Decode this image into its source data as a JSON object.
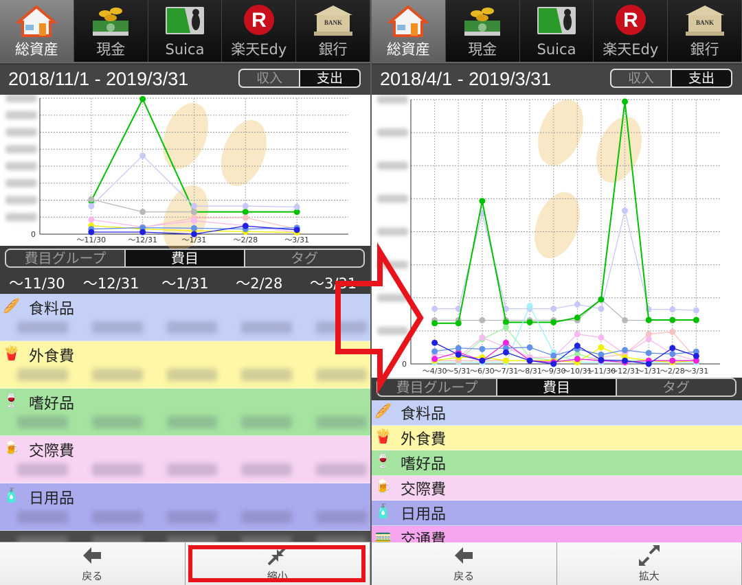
{
  "colors": {
    "accent_red": "#e8141c",
    "selected_tab": "#777777",
    "header_bg": "#444444"
  },
  "nav_tabs": [
    {
      "label": "総資産",
      "icon": "house-icon",
      "selected": true
    },
    {
      "label": "現金",
      "icon": "cash-icon",
      "selected": false
    },
    {
      "label": "Suica",
      "icon": "suica-card-icon",
      "selected": false
    },
    {
      "label": "楽天Edy",
      "icon": "rakuten-r-icon",
      "selected": false
    },
    {
      "label": "銀行",
      "icon": "bank-icon",
      "selected": false
    }
  ],
  "toggle": {
    "income": "収入",
    "expense": "支出",
    "selected": "支出"
  },
  "segments": {
    "items": [
      "費目グループ",
      "費目",
      "タグ"
    ],
    "selected": "費目"
  },
  "left_panel": {
    "date_range": "2018/11/1 - 2019/3/31",
    "columns": [
      "〜11/30",
      "〜12/31",
      "〜1/31",
      "〜2/28",
      "〜3/31"
    ],
    "rows": [
      {
        "name": "食料品",
        "icon": "bread-icon",
        "color": "#c4d0f6"
      },
      {
        "name": "外食費",
        "icon": "fast-food-icon",
        "color": "#fdf7a6"
      },
      {
        "name": "嗜好品",
        "icon": "wine-glass-icon",
        "color": "#a4e4a0"
      },
      {
        "name": "交際費",
        "icon": "beer-icon",
        "color": "#f7d4f2"
      },
      {
        "name": "日用品",
        "icon": "daily-goods-icon",
        "color": "#aaaaee"
      }
    ],
    "bottom": [
      {
        "label": "戻る",
        "icon": "arrow-left-icon"
      },
      {
        "label": "縮小",
        "icon": "shrink-icon",
        "highlighted": true
      }
    ]
  },
  "right_panel": {
    "date_range": "2018/4/1 - 2019/3/31",
    "rows": [
      {
        "name": "食料品",
        "icon": "bread-icon",
        "color": "#c4d0f6"
      },
      {
        "name": "外食費",
        "icon": "fast-food-icon",
        "color": "#fdf7a6"
      },
      {
        "name": "嗜好品",
        "icon": "wine-glass-icon",
        "color": "#a4e4a0"
      },
      {
        "name": "交際費",
        "icon": "beer-icon",
        "color": "#f7d4f2"
      },
      {
        "name": "日用品",
        "icon": "daily-goods-icon",
        "color": "#aaaaee"
      },
      {
        "name": "交通費",
        "icon": "train-icon",
        "color": "#f5a6ee"
      }
    ],
    "bottom": [
      {
        "label": "戻る",
        "icon": "arrow-left-icon"
      },
      {
        "label": "拡大",
        "icon": "expand-icon"
      }
    ]
  },
  "chart_data": [
    {
      "type": "line",
      "title": "",
      "xlabel": "",
      "ylabel": "",
      "categories": [
        "〜11/30",
        "〜12/31",
        "〜1/31",
        "〜2/28",
        "〜3/31"
      ],
      "ylim": [
        0,
        8
      ],
      "y_tick_labels_visible": [
        "0"
      ],
      "grid": true,
      "series": [
        {
          "color": "#00c000",
          "values": [
            1.96,
            7.95,
            1.31,
            1.31,
            1.31
          ]
        },
        {
          "color": "#c8c8f8",
          "values": [
            1.65,
            4.62,
            1.65,
            1.65,
            1.6
          ]
        },
        {
          "color": "#b8b8b8",
          "values": [
            2.05,
            1.31,
            1.31,
            null,
            null
          ]
        },
        {
          "color": "#f8c0c0",
          "values": [
            0.3,
            0.4,
            0.95,
            0.97,
            0.3
          ]
        },
        {
          "color": "#f8b8f0",
          "values": [
            0.85,
            0.42,
            0.78,
            0.5,
            0.1
          ]
        },
        {
          "color": "#f0f000",
          "values": [
            0.5,
            0.3,
            0.2,
            0.15,
            0.1
          ]
        },
        {
          "color": "#6090e8",
          "values": [
            0.3,
            0.38,
            0.35,
            0.3,
            0.38
          ]
        },
        {
          "color": "#2020e0",
          "values": [
            0.12,
            0.12,
            0.0,
            0.48,
            0.25
          ]
        }
      ]
    },
    {
      "type": "line",
      "title": "",
      "xlabel": "",
      "ylabel": "",
      "categories": [
        "〜4/30",
        "〜5/31",
        "〜6/30",
        "〜7/31",
        "〜8/31",
        "〜9/30",
        "〜10/31",
        "〜11/30",
        "〜12/31",
        "〜1/31",
        "〜2/28",
        "〜3/31"
      ],
      "ylim": [
        0,
        8
      ],
      "y_tick_labels_visible": [
        "0"
      ],
      "grid": true,
      "series": [
        {
          "color": "#b8b8b8",
          "values": [
            1.32,
            1.32,
            1.32,
            1.32,
            1.32,
            1.32,
            1.32,
            1.95,
            1.32,
            1.32,
            1.32,
            1.32
          ]
        },
        {
          "color": "#c8c8f8",
          "values": [
            1.67,
            1.67,
            4.55,
            1.67,
            1.67,
            1.67,
            1.8,
            1.67,
            4.64,
            1.65,
            1.65,
            1.62
          ]
        },
        {
          "color": "#00c000",
          "values": [
            1.23,
            1.23,
            4.93,
            1.26,
            1.26,
            1.26,
            1.4,
            1.95,
            7.94,
            1.33,
            1.33,
            1.33
          ]
        },
        {
          "color": "#a0f0a0",
          "values": [
            0.1,
            0.1,
            0.75,
            1.1,
            0.2,
            0.1,
            0.3,
            0.1,
            0.1,
            0.1,
            0.1,
            0.1
          ]
        },
        {
          "color": "#a0f0f8",
          "values": [
            0.05,
            0.05,
            0.05,
            0.05,
            1.75,
            0.35,
            0.05,
            0.05,
            0.05,
            0.05,
            0.05,
            0.05
          ]
        },
        {
          "color": "#f8c0c0",
          "values": [
            0.1,
            0.1,
            0.1,
            0.1,
            0.1,
            0.1,
            0.1,
            0.2,
            0.3,
            0.9,
            0.97,
            0.15
          ]
        },
        {
          "color": "#f8b8f0",
          "values": [
            0.3,
            0.2,
            0.8,
            0.5,
            0.2,
            0.2,
            0.9,
            0.8,
            0.3,
            0.75,
            0.3,
            0.1
          ]
        },
        {
          "color": "#f0f000",
          "values": [
            0.1,
            0.2,
            0.2,
            0.1,
            0.1,
            0.1,
            0.05,
            0.5,
            0.2,
            0.1,
            0.05,
            0.1
          ]
        },
        {
          "color": "#f020e0",
          "values": [
            0.15,
            0.35,
            0.1,
            0.64,
            0.1,
            0.05,
            0.15,
            0.1,
            0.05,
            0.1,
            0.1,
            0.1
          ]
        },
        {
          "color": "#6090e8",
          "values": [
            0.38,
            0.48,
            0.45,
            0.48,
            0.5,
            0.25,
            0.45,
            0.28,
            0.42,
            0.33,
            0.3,
            0.37
          ]
        },
        {
          "color": "#2020e0",
          "values": [
            0.64,
            0.28,
            0.1,
            0.35,
            0.1,
            0.0,
            0.55,
            0.12,
            0.1,
            0.0,
            0.48,
            0.24
          ]
        }
      ]
    }
  ]
}
